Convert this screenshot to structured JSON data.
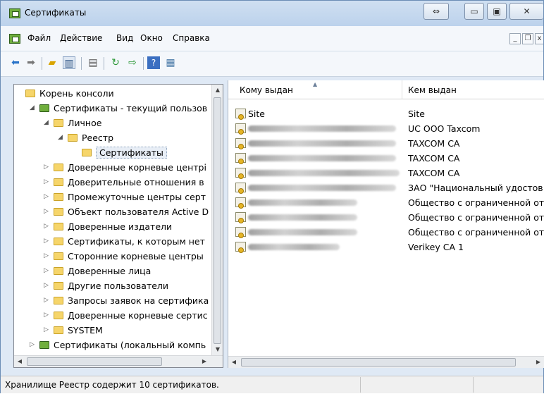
{
  "window": {
    "title": "Сертификаты"
  },
  "menu": [
    "Файл",
    "Действие",
    "Вид",
    "Окно",
    "Справка"
  ],
  "tree": [
    {
      "label": "Корень консоли",
      "arrow": ""
    },
    {
      "label": "Сертификаты - текущий пользов",
      "arrow": "◢"
    },
    {
      "label": "Личное",
      "arrow": "◢"
    },
    {
      "label": "Реестр",
      "arrow": "◢"
    },
    {
      "label": "Сертификаты",
      "arrow": ""
    },
    {
      "label": "Доверенные корневые центрі",
      "arrow": "▷"
    },
    {
      "label": "Доверительные отношения в",
      "arrow": "▷"
    },
    {
      "label": "Промежуточные центры серт",
      "arrow": "▷"
    },
    {
      "label": "Объект пользователя Active D",
      "arrow": "▷"
    },
    {
      "label": "Доверенные издатели",
      "arrow": "▷"
    },
    {
      "label": "Сертификаты, к которым нет",
      "arrow": "▷"
    },
    {
      "label": "Сторонние корневые центры",
      "arrow": "▷"
    },
    {
      "label": "Доверенные лица",
      "arrow": "▷"
    },
    {
      "label": "Другие пользователи",
      "arrow": "▷"
    },
    {
      "label": "Запросы заявок на сертифика",
      "arrow": "▷"
    },
    {
      "label": "Доверенные корневые сертис",
      "arrow": "▷"
    },
    {
      "label": "SYSTEM",
      "arrow": "▷"
    },
    {
      "label": "Сертификаты (локальный компь",
      "arrow": "▷"
    }
  ],
  "list": {
    "columns": [
      "Кому выдан",
      "Кем выдан"
    ],
    "rows": [
      {
        "to": "Site",
        "by": "Site"
      },
      {
        "to": "",
        "by": "UC OOO Taxcom"
      },
      {
        "to": "",
        "by": "TAXCOM CA"
      },
      {
        "to": "",
        "by": "TAXCOM CA"
      },
      {
        "to": "",
        "by": "TAXCOM CA"
      },
      {
        "to": "",
        "by": "ЗАО \"Национальный удостов"
      },
      {
        "to": "",
        "by": "Общество с ограниченной от"
      },
      {
        "to": "",
        "by": "Общество с ограниченной от"
      },
      {
        "to": "",
        "by": "Общество с ограниченной от"
      },
      {
        "to": "",
        "by": "Verikey CA 1"
      }
    ]
  },
  "status": "Хранилище Реестр содержит 10 сертификатов."
}
